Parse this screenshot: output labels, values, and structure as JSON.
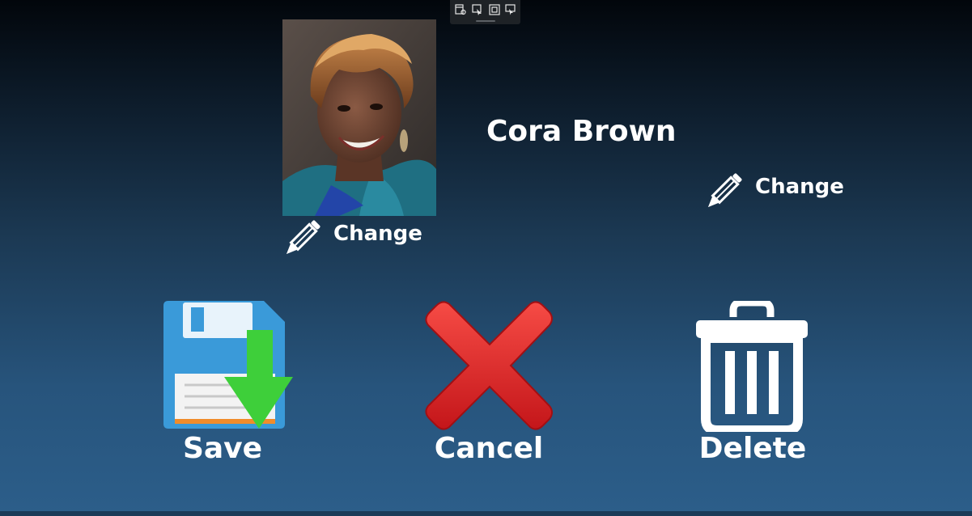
{
  "toolbar": {
    "icons": [
      "capture-window-icon",
      "select-region-icon",
      "fullscreen-icon",
      "record-screen-icon"
    ]
  },
  "contact": {
    "name": "Cora Brown",
    "photo_alt": "contact-photo"
  },
  "photo_change": {
    "label": "Change",
    "icon": "pencil-icon"
  },
  "name_change": {
    "label": "Change",
    "icon": "pencil-icon"
  },
  "actions": {
    "save": {
      "label": "Save",
      "icon": "floppy-disk-save-icon"
    },
    "cancel": {
      "label": "Cancel",
      "icon": "red-x-icon"
    },
    "delete": {
      "label": "Delete",
      "icon": "trash-can-icon"
    }
  },
  "colors": {
    "background_top": "#02060b",
    "background_bottom": "#2c5e8a",
    "save_blue": "#3a9ad9",
    "save_green": "#3ecf3a",
    "cancel_red": "#e0262a",
    "text": "#ffffff"
  }
}
